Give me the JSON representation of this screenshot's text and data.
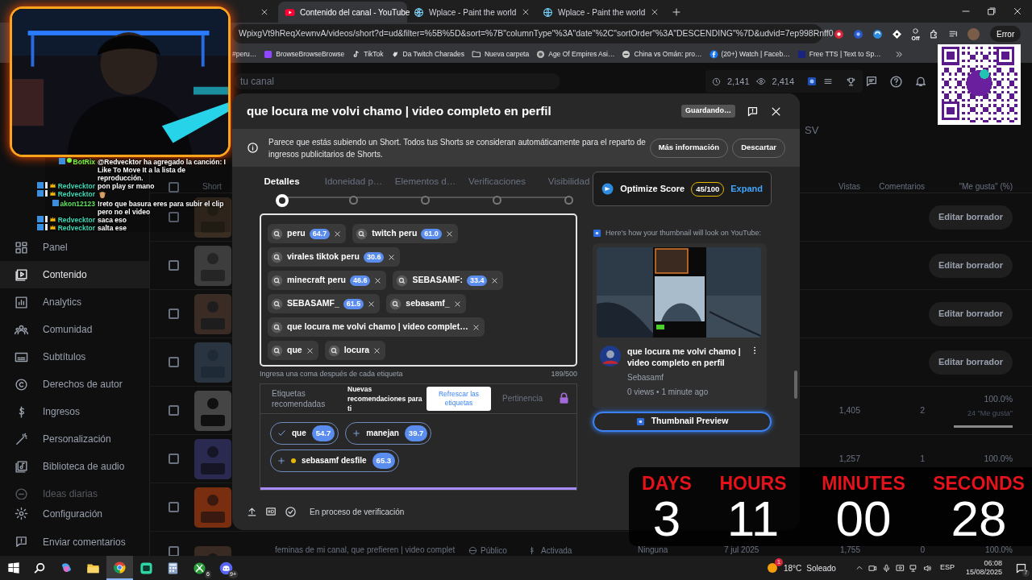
{
  "browser": {
    "tabs": [
      {
        "title": "Contenido del canal - YouTube",
        "selected": true
      },
      {
        "title": "Wplace - Paint the world",
        "selected": false
      },
      {
        "title": "Wplace - Paint the world",
        "selected": false
      }
    ],
    "url": "WpixgVt9hReqXewnvA/videos/short?d=ud&filter=%5B%5D&sort=%7B\"columnType\"%3A\"date\"%2C\"sortOrder\"%3A\"DESCENDING\"%7D&udvid=7ep998Rnff0",
    "extension_label": "Off",
    "profile_button": "Error",
    "bookmarks": [
      "#peru…",
      "BrowseBrowseBrowse",
      "TikTok",
      "Da Twitch Charades",
      "Nueva carpeta",
      "Age Of Empires Asi…",
      "China vs Omán: pro…",
      "(20+) Watch | Faceb…",
      "Free TTS | Text to Sp…"
    ]
  },
  "studio": {
    "search_placeholder": "tu canal",
    "stats": [
      "2,141",
      "2,414"
    ],
    "sidebar": {
      "items": [
        {
          "label": "Panel",
          "selected": false
        },
        {
          "label": "Contenido",
          "selected": true
        },
        {
          "label": "Analytics",
          "selected": false
        },
        {
          "label": "Comunidad",
          "selected": false
        },
        {
          "label": "Subtítulos",
          "selected": false
        },
        {
          "label": "Derechos de autor",
          "selected": false
        },
        {
          "label": "Ingresos",
          "selected": false
        },
        {
          "label": "Personalización",
          "selected": false
        },
        {
          "label": "Biblioteca de audio",
          "selected": false
        },
        {
          "label": "Ideas diarias",
          "selected": false
        }
      ],
      "footer_items": [
        "Configuración",
        "Enviar comentarios"
      ]
    },
    "export_label": "SV",
    "table": {
      "columns": [
        "Short",
        "Vistas",
        "Comentarios",
        "\"Me gusta\" (%)"
      ],
      "select_all_checked": false,
      "rows": [
        {
          "kind": "draft",
          "checked": false,
          "action": "Editar borrador"
        },
        {
          "kind": "draft",
          "checked": false,
          "action": "Editar borrador"
        },
        {
          "kind": "draft",
          "checked": false,
          "action": "Editar borrador"
        },
        {
          "kind": "draft",
          "checked": false,
          "action": "Editar borrador"
        },
        {
          "kind": "stats",
          "checked": false,
          "views": "1,405",
          "comments": "2",
          "likes": "100.0%",
          "likes_count": "24 \"Me gusta\"",
          "level": 1
        },
        {
          "kind": "stats",
          "checked": false,
          "views": "1,257",
          "comments": "1",
          "likes": "100.0%"
        },
        {
          "kind": "covered",
          "checked": false
        },
        {
          "kind": "full",
          "checked": false,
          "title": "feminas de mi canal, que prefieren | video complet",
          "visibility": "Público",
          "restrictions": "Activada",
          "column_5": "Ninguna",
          "date": "7 jul 2025",
          "views": "1,755",
          "comments": "0",
          "likes": "100.0%"
        }
      ]
    }
  },
  "modal": {
    "title": "que locura me volvi chamo | video completo en perfil",
    "save_status": "Guardando…",
    "notice": {
      "text": "Parece que estás subiendo un Short. Todos tus Shorts se consideran automáticamente para el reparto de ingresos publicitarios de Shorts.",
      "buttons": [
        "Más información",
        "Descartar"
      ]
    },
    "steps": [
      {
        "label": "Detalles",
        "selected": true
      },
      {
        "label": "Idoneidad p…",
        "selected": false
      },
      {
        "label": "Elementos d…",
        "selected": false
      },
      {
        "label": "Verificaciones",
        "selected": false
      },
      {
        "label": "Visibilidad",
        "selected": false
      }
    ],
    "optimize": {
      "label": "Optimize Score",
      "score": "45/100",
      "action": "Expand"
    },
    "tags": [
      {
        "text": "peru",
        "score": "64.7"
      },
      {
        "text": "twitch peru",
        "score": "61.0"
      },
      {
        "text": "virales tiktok peru",
        "score": "30.6"
      },
      {
        "text": "minecraft peru",
        "score": "46.6"
      },
      {
        "text": "SEBASAMF:",
        "score": "33.4"
      },
      {
        "text": "SEBASAMF_",
        "score": "61.5"
      },
      {
        "text": "sebasamf_"
      },
      {
        "text": "que locura me volvi chamo | video complet…"
      },
      {
        "text": "que"
      },
      {
        "text": "locura"
      }
    ],
    "tags_hint": "Ingresa una coma después de cada etiqueta",
    "tags_count": "189/500",
    "recommendations": {
      "tabs": [
        {
          "label": "Etiquetas recomendadas",
          "selected": false
        },
        {
          "label": "Nuevas recomendaciones para ti",
          "selected": true
        }
      ],
      "refresh_button": "Refrescar las etiquetas",
      "locked_tab": "Pertinencia",
      "chips": [
        {
          "text": "que",
          "score": "54.7",
          "kind": "added",
          "dot": false
        },
        {
          "text": "manejan",
          "score": "39.7",
          "kind": "suggested",
          "dot": false
        },
        {
          "text": "sebasamf desfile",
          "score": "65.3",
          "kind": "suggested",
          "dot": true
        }
      ]
    },
    "preview": {
      "caption": "Here's how your thumbnail will look on YouTube:",
      "video_title": "que locura me volvi chamo | video completo en perfil",
      "channel": "Sebasamf",
      "meta": "0 views • 1 minute ago",
      "button": "Thumbnail Preview"
    },
    "footer_status": "En proceso de verificación"
  },
  "chat": [
    {
      "user": "BotRix",
      "kind": "bot",
      "color": "#7cfc3c",
      "text": "@Redvecktor ha agregado la canción: I Like To Move It a la lista de reproducción.",
      "emote": false
    },
    {
      "user": "Redvecktor",
      "kind": "vip",
      "color": "#3fd9b5",
      "text": "pon play sr mano",
      "emote": false
    },
    {
      "user": "Redvecktor",
      "kind": "vip",
      "color": "#3fd9b5",
      "emote": true
    },
    {
      "user": "akon12123",
      "kind": "viewer",
      "color": "#5ee65e",
      "text": "!reto que basura eres para subir el clip pero no el video",
      "emote": false
    },
    {
      "user": "Redvecktor",
      "kind": "vip",
      "color": "#3fd9b5",
      "text": "saca eso",
      "emote": false
    },
    {
      "user": "Redvecktor",
      "kind": "vip",
      "color": "#3fd9b5",
      "text": "salta ese",
      "emote": false
    }
  ],
  "countdown": [
    {
      "label": "DAYS",
      "value": "3"
    },
    {
      "label": "HOURS",
      "value": "11"
    },
    {
      "label": "MINUTES",
      "value": "00"
    },
    {
      "label": "SECONDS",
      "value": "28"
    }
  ],
  "taskbar": {
    "apps": [
      {
        "selected": false
      },
      {
        "selected": false
      },
      {
        "selected": false
      },
      {
        "selected": false
      },
      {
        "selected": true
      },
      {
        "selected": false
      },
      {
        "selected": false
      },
      {
        "selected": false,
        "badge": "6"
      },
      {
        "selected": false,
        "badge": "9+"
      }
    ],
    "weather": {
      "alert": "1",
      "temp": "18°C",
      "condition": "Soleado"
    },
    "language": "ESP",
    "time": "06:08",
    "date": "15/08/2025",
    "notifications": "7"
  }
}
